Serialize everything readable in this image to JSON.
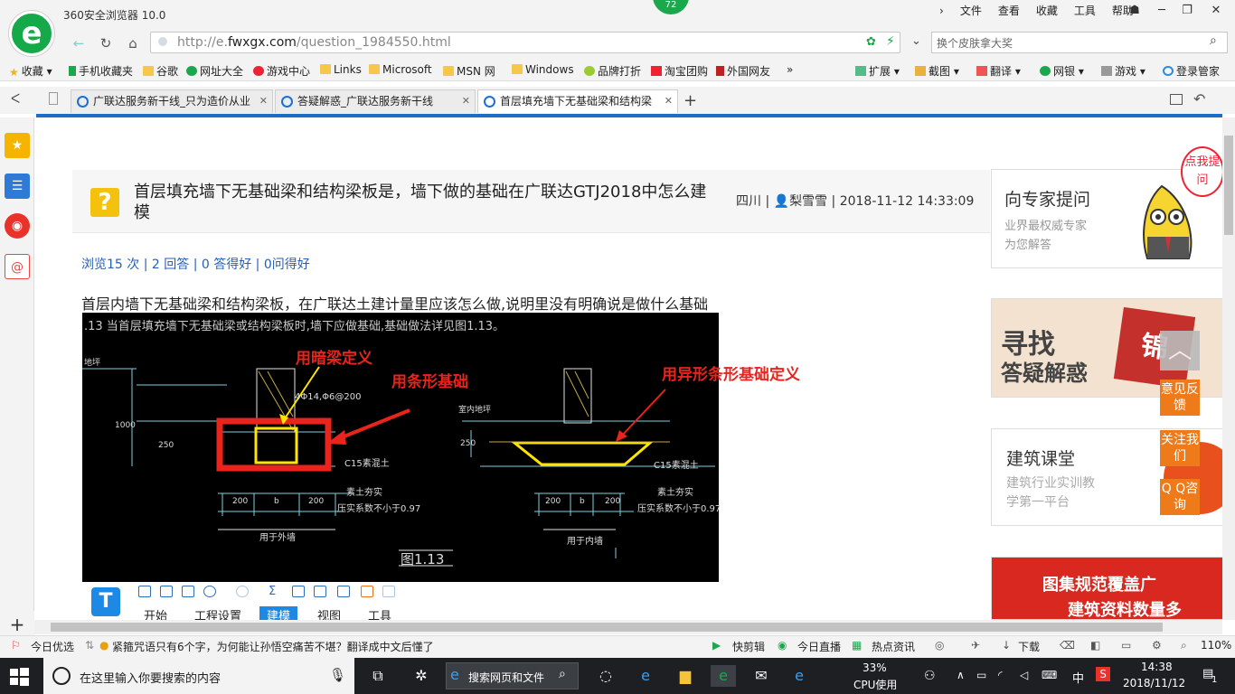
{
  "browser": {
    "title": "360安全浏览器 10.0",
    "badge_count": "72",
    "menu": [
      "文件",
      "查看",
      "收藏",
      "工具",
      "帮助"
    ],
    "url_prefix": "http://e.",
    "url_domain": "fwxgx.com",
    "url_path": "/question_1984550.html",
    "search_placeholder": "换个皮肤拿大奖"
  },
  "bookmarks": [
    "收藏",
    "手机收藏夹",
    "谷歌",
    "网址大全",
    "游戏中心",
    "Links",
    "Microsoft",
    "MSN 网",
    "Windows",
    "品牌打折",
    "淘宝团购",
    "外国网友"
  ],
  "bookmarks_more": "»",
  "toolbar_right": [
    "扩展",
    "截图",
    "翻译",
    "网银",
    "游戏",
    "登录管家"
  ],
  "tabs": [
    {
      "label": "广联达服务新干线_只为造价从业"
    },
    {
      "label": "答疑解惑_广联达服务新干线"
    },
    {
      "label": "首层填充墙下无基础梁和结构梁"
    }
  ],
  "question": {
    "title": "首层填充墙下无基础梁和结构梁板是，墙下做的基础在广联达GTJ2018中怎么建模",
    "region": "四川",
    "author": "梨雪雪",
    "datetime": "2018-11-12 14:33:09",
    "stats": "浏览15 次 | 2 回答 | 0 答得好 | 0问得好",
    "body": "首层内墙下无基础梁和结构梁板，在广联达土建计量里应该怎么做,说明里没有明确说是做什么基础"
  },
  "cad": {
    "note": ".13  当首层填充墙下无基础梁或结构梁板时,墙下应做基础,基础做法详见图1.13。",
    "label_hidden_beam": "用暗梁定义",
    "label_strip": "用条形基础",
    "label_special_strip": "用异形条形基础定义",
    "rebar": "4Φ14,Φ6@200",
    "concrete": "C15素混土",
    "soil": "素土夯实",
    "compaction": "压实系数不小于0.97",
    "dim_200a": "200",
    "dim_b": "b",
    "dim_200b": "200",
    "dim_250": "250",
    "dim_1000": "1000",
    "caption_left": "用于外墙",
    "caption_right": "用于内墙",
    "figure": "图1.13",
    "ground_left": "地坪",
    "ground_right": "室内地坪"
  },
  "app_toolbar": {
    "logo": "T",
    "tabs": [
      "开始",
      "工程设置",
      "建模",
      "视图",
      "工具"
    ],
    "active_tab": "建模"
  },
  "right": {
    "expert_title": "向专家提问",
    "expert_sub1": "业界最权威专家",
    "expert_sub2": "为您解答",
    "ask_tab": "点我提问",
    "find_line1": "寻找",
    "find_line2": "答疑解惑",
    "find_seal": "锦",
    "course_title": "建筑课堂",
    "course_sub1": "建筑行业实训教",
    "course_sub2": "学第一平台",
    "atlas_line1": "图集规范覆盖广",
    "atlas_line2": "建筑资料数量多",
    "feedback": "意见反馈",
    "follow": "关注我们",
    "qq": "Q Q咨询"
  },
  "statusbar": {
    "today": "今日优选",
    "news": "紧箍咒语只有6个字，为何能让孙悟空痛苦不堪？翻译成中文后懂了",
    "items": [
      "快剪辑",
      "今日直播",
      "热点资讯"
    ],
    "download": "下载",
    "zoom": "110%"
  },
  "taskbar": {
    "search_placeholder": "在这里输入你要搜索的内容",
    "web_search": "搜索网页和文件",
    "cpu_pct": "33%",
    "cpu_label": "CPU使用",
    "ime": "中",
    "time": "14:38",
    "date": "2018/11/12",
    "notif": "1"
  }
}
